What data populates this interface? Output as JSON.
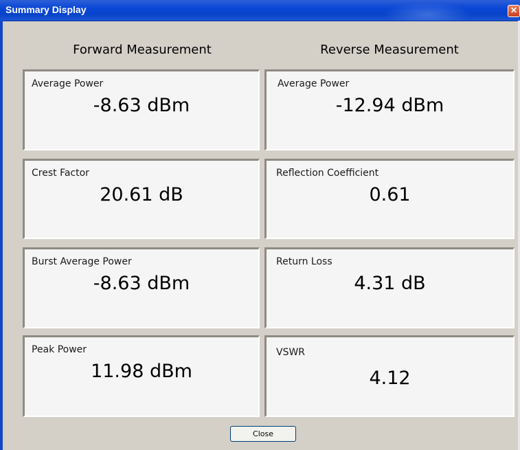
{
  "window": {
    "title": "Summary Display",
    "close_glyph": "✕"
  },
  "columns": {
    "forward_heading": "Forward Measurement",
    "reverse_heading": "Reverse Measurement"
  },
  "forward": [
    {
      "label": "Average Power",
      "value": "-8.63 dBm"
    },
    {
      "label": "Crest Factor",
      "value": "20.61 dB"
    },
    {
      "label": "Burst Average Power",
      "value": "-8.63 dBm"
    },
    {
      "label": "Peak Power",
      "value": "11.98 dBm"
    }
  ],
  "reverse": [
    {
      "label": "Average Power",
      "value": "-12.94 dBm"
    },
    {
      "label": "Reflection Coefficient",
      "value": "0.61"
    },
    {
      "label": "Return Loss",
      "value": "4.31 dB"
    },
    {
      "label": "VSWR",
      "value": "4.12"
    }
  ],
  "buttons": {
    "close_label": "Close"
  },
  "colors": {
    "titlebar": "#0a46d6",
    "dialog_background": "#d4d0c8",
    "card_background": "#f5f5f5"
  }
}
